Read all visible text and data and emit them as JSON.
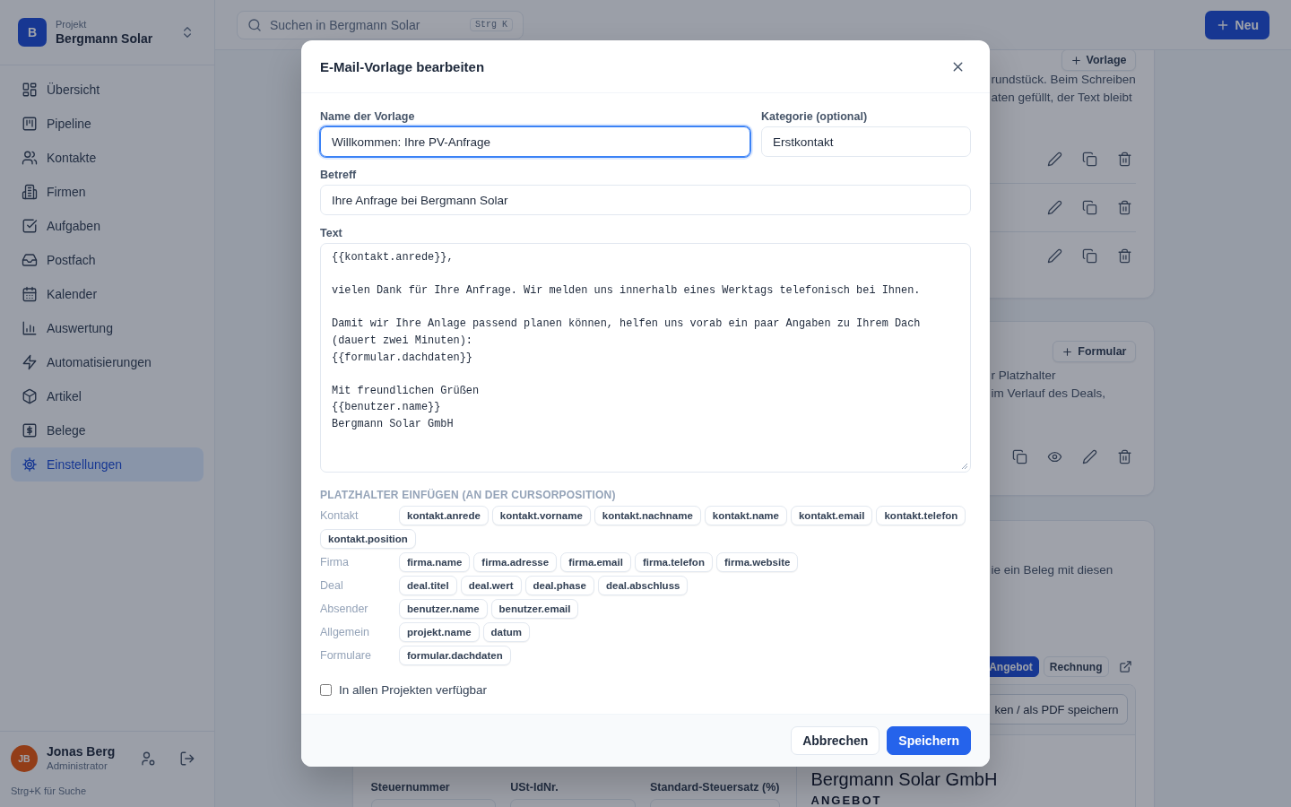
{
  "sidebar": {
    "logo_letter": "B",
    "project_label": "Projekt",
    "project_name": "Bergmann Solar",
    "items": [
      {
        "label": "Übersicht",
        "selected": false
      },
      {
        "label": "Pipeline",
        "selected": false
      },
      {
        "label": "Kontakte",
        "selected": false
      },
      {
        "label": "Firmen",
        "selected": false
      },
      {
        "label": "Aufgaben",
        "selected": false
      },
      {
        "label": "Postfach",
        "selected": false
      },
      {
        "label": "Kalender",
        "selected": false
      },
      {
        "label": "Auswertung",
        "selected": false
      },
      {
        "label": "Automatisierungen",
        "selected": false
      },
      {
        "label": "Artikel",
        "selected": false
      },
      {
        "label": "Belege",
        "selected": false
      },
      {
        "label": "Einstellungen",
        "selected": true
      }
    ],
    "user": {
      "initials": "JB",
      "name": "Jonas Berg",
      "role": "Administrator"
    },
    "hint": "Strg+K für Suche"
  },
  "topbar": {
    "search": {
      "placeholder": "Suchen in Bergmann Solar",
      "shortcut": "Strg K"
    },
    "new_button": "Neu"
  },
  "background": {
    "templates_card": {
      "add_button": "Vorlage",
      "description_lines": [
        "rundstück. Beim Schreiben",
        "aten gefüllt, der Text bleibt"
      ]
    },
    "forms_card": {
      "add_button": "Formular",
      "description_lines": [
        "r Platzhalter",
        "im Verlauf des Deals,"
      ]
    },
    "documents_card": {
      "description": "ie ein Beleg mit diesen",
      "tabs": [
        {
          "label": "Angebot",
          "selected": true
        },
        {
          "label": "Rechnung",
          "selected": false
        }
      ],
      "print_button": "ken / als PDF speichern",
      "preview_company": "Bergmann Solar GmbH",
      "preview_doc_type": "ANGEBOT",
      "fields": [
        {
          "label": "Steuernummer"
        },
        {
          "label": "USt-IdNr."
        },
        {
          "label": "Standard-Steuersatz (%)"
        }
      ]
    }
  },
  "dialog": {
    "title": "E-Mail-Vorlage bearbeiten",
    "fields": [
      {
        "label": "Name der Vorlage",
        "value": "Willkommen: Ihre PV-Anfrage",
        "focused": true
      },
      {
        "label": "Kategorie (optional)",
        "value": "Erstkontakt",
        "focused": false
      },
      {
        "label": "Betreff",
        "value": "Ihre Anfrage bei Bergmann Solar",
        "focused": false
      }
    ],
    "body": {
      "label": "Text",
      "value": "{{kontakt.anrede}},\n\nvielen Dank für Ihre Anfrage. Wir melden uns innerhalb eines Werktags telefonisch bei Ihnen.\n\nDamit wir Ihre Anlage passend planen können, helfen uns vorab ein paar Angaben zu Ihrem Dach (dauert zwei Minuten):\n{{formular.dachdaten}}\n\nMit freundlichen Grüßen\n{{benutzer.name}}\nBergmann Solar GmbH"
    },
    "placeholders": {
      "title": "PLATZHALTER EINFÜGEN (AN DER CURSORPOSITION)",
      "groups": [
        {
          "label": "Kontakt",
          "chips": [
            "kontakt.anrede",
            "kontakt.vorname",
            "kontakt.nachname",
            "kontakt.name",
            "kontakt.email",
            "kontakt.telefon",
            "kontakt.position"
          ]
        },
        {
          "label": "Firma",
          "chips": [
            "firma.name",
            "firma.adresse",
            "firma.email",
            "firma.telefon",
            "firma.website"
          ]
        },
        {
          "label": "Deal",
          "chips": [
            "deal.titel",
            "deal.wert",
            "deal.phase",
            "deal.abschluss"
          ]
        },
        {
          "label": "Absender",
          "chips": [
            "benutzer.name",
            "benutzer.email"
          ]
        },
        {
          "label": "Allgemein",
          "chips": [
            "projekt.name",
            "datum"
          ]
        },
        {
          "label": "Formulare",
          "chips": [
            "formular.dachdaten"
          ]
        }
      ]
    },
    "share_checkbox": {
      "label": "In allen Projekten verfügbar",
      "checked": false
    },
    "buttons": [
      {
        "label": "Abbrechen",
        "kind": "secondary"
      },
      {
        "label": "Speichern",
        "kind": "primary"
      }
    ]
  }
}
